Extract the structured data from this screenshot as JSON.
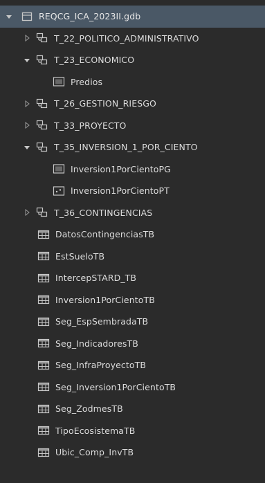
{
  "root": {
    "label": "REQCG_ICA_2023II.gdb"
  },
  "datasets": [
    {
      "label": "T_22_POLITICO_ADMINISTRATIVO",
      "expanded": false
    },
    {
      "label": "T_23_ECONOMICO",
      "expanded": true,
      "children": [
        {
          "label": "Predios",
          "kind": "polygon"
        }
      ]
    },
    {
      "label": "T_26_GESTION_RIESGO",
      "expanded": false
    },
    {
      "label": "T_33_PROYECTO",
      "expanded": false
    },
    {
      "label": "T_35_INVERSION_1_POR_CIENTO",
      "expanded": true,
      "children": [
        {
          "label": "Inversion1PorCientoPG",
          "kind": "polygon"
        },
        {
          "label": "Inversion1PorCientoPT",
          "kind": "point"
        }
      ]
    },
    {
      "label": "T_36_CONTINGENCIAS",
      "expanded": false
    }
  ],
  "tables": [
    "DatosContingenciasTB",
    "EstSueloTB",
    "IntercepSTARD_TB",
    "Inversion1PorCientoTB",
    "Seg_EspSembradaTB",
    "Seg_IndicadoresTB",
    "Seg_InfraProyectoTB",
    "Seg_Inversion1PorCientoTB",
    "Seg_ZodmesTB",
    "TipoEcosistemaTB",
    "Ubic_Comp_InvTB"
  ],
  "colors": {
    "background": "#2b2b2b",
    "selected_row": "#4a5866",
    "text": "#dcdcdc",
    "icon": "#b9b9b9"
  },
  "icons": {
    "expanded": "triangle-down-icon",
    "collapsed": "triangle-right-icon",
    "database": "geodatabase-icon",
    "dataset": "feature-dataset-icon",
    "polygon": "polygon-feature-class-icon",
    "point": "point-feature-class-icon",
    "table": "table-icon"
  }
}
